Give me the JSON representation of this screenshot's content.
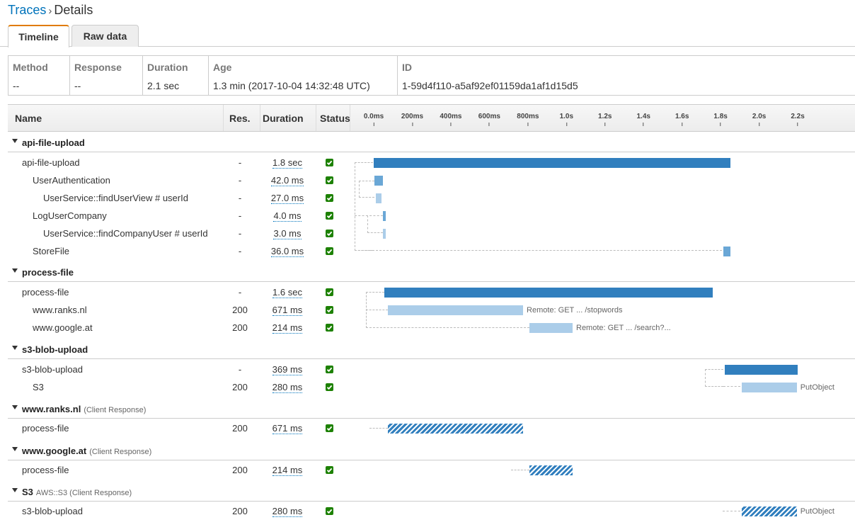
{
  "breadcrumb": {
    "parent": "Traces",
    "separator": "›",
    "current": "Details"
  },
  "tabs": [
    {
      "label": "Timeline",
      "active": true
    },
    {
      "label": "Raw data",
      "active": false
    }
  ],
  "summary": {
    "method": {
      "label": "Method",
      "value": "--"
    },
    "response": {
      "label": "Response",
      "value": "--"
    },
    "duration": {
      "label": "Duration",
      "value": "2.1 sec"
    },
    "age": {
      "label": "Age",
      "value": "1.3 min (2017-10-04 14:32:48 UTC)"
    },
    "id": {
      "label": "ID",
      "value": "1-59d4f110-a5af92ef01159da1af1d15d5"
    }
  },
  "table_header": {
    "name": "Name",
    "res": "Res.",
    "duration": "Duration",
    "status": "Status"
  },
  "timeline_ticks": [
    "0.0ms",
    "200ms",
    "400ms",
    "600ms",
    "800ms",
    "1.0s",
    "1.2s",
    "1.4s",
    "1.6s",
    "1.8s",
    "2.0s",
    "2.2s"
  ],
  "timeline_scale": {
    "min_s": 0,
    "max_tick_s": 2.2
  },
  "colors": {
    "root_bar": "#317fbe",
    "child_bar": "#6aa7d6",
    "remote_bar": "#abcde9",
    "status_ok": "#1d8102",
    "accent_tab": "#e07b00",
    "link": "#0073bb"
  },
  "groups": [
    {
      "name": "api-file-upload",
      "sub": "",
      "rows": [
        {
          "name": "api-file-upload",
          "indent": 0,
          "res": "-",
          "duration": "1.8 sec",
          "status": "ok",
          "start_s": 0.0,
          "end_s": 1.85,
          "style": "root",
          "label": ""
        },
        {
          "name": "UserAuthentication",
          "indent": 1,
          "res": "-",
          "duration": "42.0 ms",
          "status": "ok",
          "start_s": 0.005,
          "end_s": 0.047,
          "style": "mid",
          "label": ""
        },
        {
          "name": "UserService::findUserView # userId",
          "indent": 2,
          "res": "-",
          "duration": "27.0 ms",
          "status": "ok",
          "start_s": 0.012,
          "end_s": 0.039,
          "style": "light",
          "label": ""
        },
        {
          "name": "LogUserCompany",
          "indent": 1,
          "res": "-",
          "duration": "4.0 ms",
          "status": "ok",
          "start_s": 0.048,
          "end_s": 0.052,
          "style": "mid",
          "label": ""
        },
        {
          "name": "UserService::findCompanyUser # userId",
          "indent": 2,
          "res": "-",
          "duration": "3.0 ms",
          "status": "ok",
          "start_s": 0.048,
          "end_s": 0.051,
          "style": "light",
          "label": ""
        },
        {
          "name": "StoreFile",
          "indent": 1,
          "res": "-",
          "duration": "36.0 ms",
          "status": "ok",
          "start_s": 1.814,
          "end_s": 1.85,
          "style": "mid",
          "label": ""
        }
      ]
    },
    {
      "name": "process-file",
      "sub": "",
      "rows": [
        {
          "name": "process-file",
          "indent": 0,
          "res": "-",
          "duration": "1.6 sec",
          "status": "ok",
          "start_s": 0.055,
          "end_s": 1.76,
          "style": "root",
          "label": ""
        },
        {
          "name": "www.ranks.nl",
          "indent": 1,
          "res": "200",
          "duration": "671 ms",
          "status": "ok",
          "start_s": 0.075,
          "end_s": 0.775,
          "style": "light",
          "label": "Remote: GET ... /stopwords"
        },
        {
          "name": "www.google.at",
          "indent": 1,
          "res": "200",
          "duration": "214 ms",
          "status": "ok",
          "start_s": 0.808,
          "end_s": 1.032,
          "style": "light",
          "label": "Remote: GET ... /search?..."
        }
      ]
    },
    {
      "name": "s3-blob-upload",
      "sub": "",
      "rows": [
        {
          "name": "s3-blob-upload",
          "indent": 0,
          "res": "-",
          "duration": "369 ms",
          "status": "ok",
          "start_s": 1.822,
          "end_s": 2.2,
          "style": "root",
          "label": ""
        },
        {
          "name": "S3",
          "indent": 1,
          "res": "200",
          "duration": "280 ms",
          "status": "ok",
          "start_s": 1.91,
          "end_s": 2.195,
          "style": "light",
          "label": "PutObject"
        }
      ]
    },
    {
      "name": "www.ranks.nl",
      "sub": "(Client Response)",
      "rows": [
        {
          "name": "process-file",
          "indent": 0,
          "res": "200",
          "duration": "671 ms",
          "status": "ok",
          "start_s": 0.075,
          "end_s": 0.775,
          "style": "hatch",
          "label": ""
        }
      ]
    },
    {
      "name": "www.google.at",
      "sub": "(Client Response)",
      "rows": [
        {
          "name": "process-file",
          "indent": 0,
          "res": "200",
          "duration": "214 ms",
          "status": "ok",
          "start_s": 0.808,
          "end_s": 1.032,
          "style": "hatch",
          "label": ""
        }
      ]
    },
    {
      "name": "S3",
      "sub": "AWS::S3 (Client Response)",
      "rows": [
        {
          "name": "s3-blob-upload",
          "indent": 0,
          "res": "200",
          "duration": "280 ms",
          "status": "ok",
          "start_s": 1.91,
          "end_s": 2.195,
          "style": "hatch",
          "label": "PutObject"
        }
      ]
    }
  ]
}
